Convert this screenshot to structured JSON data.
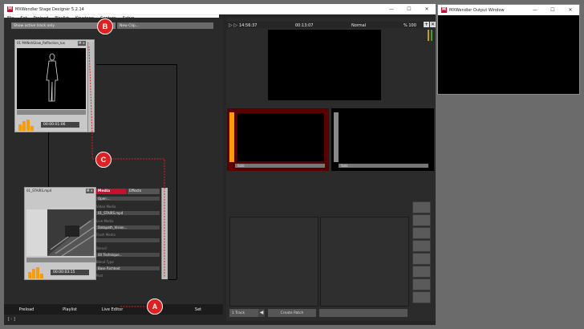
{
  "main_window": {
    "title": "MXWendler Stage Designer 5.2.14",
    "menu": [
      "File",
      "Set",
      "Preload",
      "Playlist",
      "Keystone",
      "Capture",
      "Setup"
    ]
  },
  "output_window": {
    "title": "MXWendler Output Window"
  },
  "window_controls": {
    "minimize": "—",
    "maximize": "☐",
    "close": "✕"
  },
  "toolbar": {
    "show_active": "Show active track only",
    "new_clip": "New Clip..."
  },
  "clips": [
    {
      "name": "01 MANshGlow_Reflection_lux",
      "time": "00:00:01:06"
    },
    {
      "name": "01_STAIRS.mp4",
      "time": "00:00:03:15"
    }
  ],
  "props": {
    "tabs": [
      "Media",
      "Effects"
    ],
    "open_button": "Open ...",
    "video_media_label": "Video Media",
    "video_media": "01_STAIRS.mp4",
    "live_media_label": "Live Media",
    "live_media": "Datapath_Vision...",
    "flash_media_label": "Flash Media",
    "stencil_label": "Stencil",
    "stencil": "4X Technique...",
    "blend_label": "Blend Type",
    "blend": "Base Richtext",
    "post_label": "Post"
  },
  "bottom_tabs": [
    "Preload",
    "Playlist",
    "Live Editor",
    "Set"
  ],
  "status": "[ - ]",
  "preview": {
    "clock": "14:56:37",
    "elapsed": "00:13:07",
    "mode": "Normal",
    "zoom": "% 100"
  },
  "layers": [
    {
      "label": "Solo"
    },
    {
      "label": "Solo"
    }
  ],
  "patch": {
    "track": "1 Track",
    "create": "Create Patch"
  },
  "callouts": [
    "B",
    "C",
    "A"
  ],
  "colors": {
    "accent_red": "#c8102e",
    "slider_orange": "#ff9a00",
    "callout": "#e02020"
  }
}
